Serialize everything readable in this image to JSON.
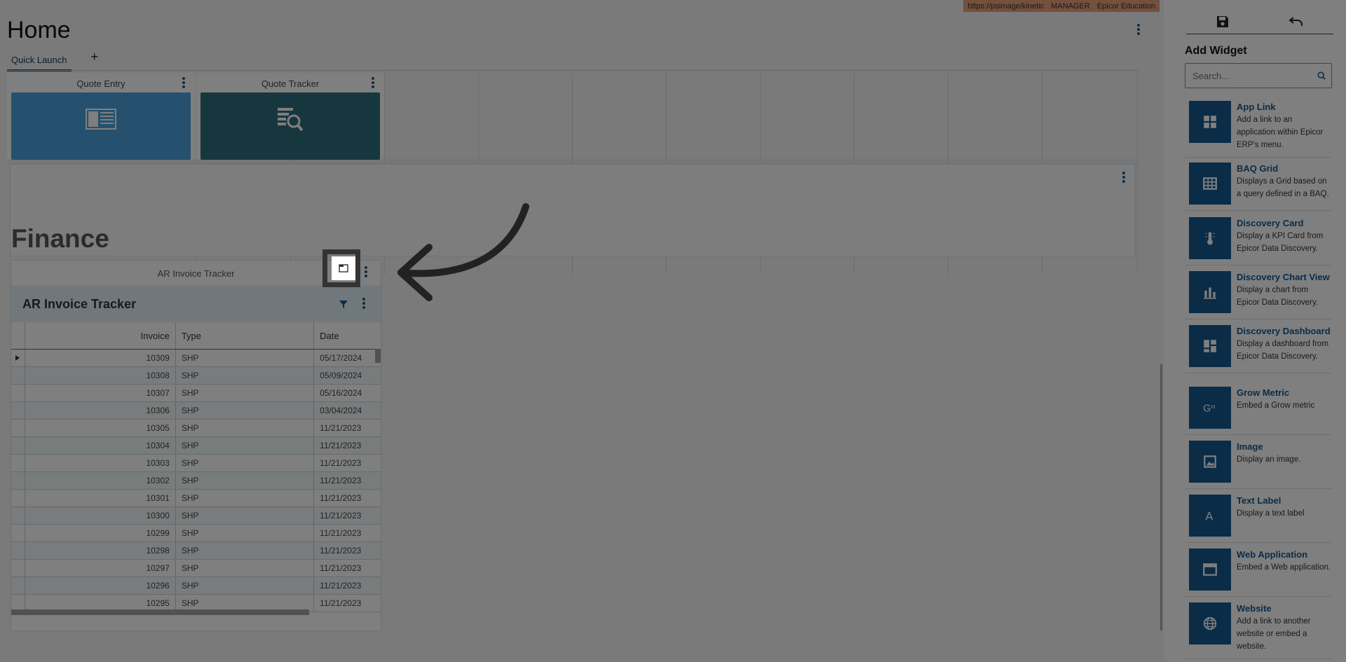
{
  "header": {
    "url": "https://psimage/kinetic",
    "user": "MANAGER",
    "company": "Epicor Education",
    "title": "Home"
  },
  "tabs": [
    {
      "label": "Quick Launch",
      "active": true
    }
  ],
  "tab_add": "+",
  "tiles": [
    {
      "title": "Quote Entry",
      "color": "#4aa3df"
    },
    {
      "title": "Quote Tracker",
      "color": "#2d6f7a"
    }
  ],
  "section": {
    "title": "Finance"
  },
  "ar_tracker": {
    "tile_title": "AR Invoice Tracker",
    "panel_title": "AR Invoice Tracker",
    "columns": [
      "Invoice",
      "Type",
      "Date"
    ],
    "rows": [
      [
        "10309",
        "SHP",
        "05/17/2024"
      ],
      [
        "10308",
        "SHP",
        "05/09/2024"
      ],
      [
        "10307",
        "SHP",
        "05/16/2024"
      ],
      [
        "10306",
        "SHP",
        "03/04/2024"
      ],
      [
        "10305",
        "SHP",
        "11/21/2023"
      ],
      [
        "10304",
        "SHP",
        "11/21/2023"
      ],
      [
        "10303",
        "SHP",
        "11/21/2023"
      ],
      [
        "10302",
        "SHP",
        "11/21/2023"
      ],
      [
        "10301",
        "SHP",
        "11/21/2023"
      ],
      [
        "10300",
        "SHP",
        "11/21/2023"
      ],
      [
        "10299",
        "SHP",
        "11/21/2023"
      ],
      [
        "10298",
        "SHP",
        "11/21/2023"
      ],
      [
        "10297",
        "SHP",
        "11/21/2023"
      ],
      [
        "10296",
        "SHP",
        "11/21/2023"
      ],
      [
        "10295",
        "SHP",
        "11/21/2023"
      ]
    ]
  },
  "side": {
    "title": "Add Widget",
    "search_placeholder": "Search...",
    "widgets": [
      {
        "name": "App Link",
        "desc": "Add a link to an application within Epicor ERP's menu.",
        "icon": "grid-icon"
      },
      {
        "name": "BAQ Grid",
        "desc": "Displays a Grid based on a query defined in a BAQ.",
        "icon": "table-icon"
      },
      {
        "name": "Discovery Card",
        "desc": "Display a KPI Card from Epicor Data Discovery.",
        "icon": "thermometer-icon"
      },
      {
        "name": "Discovery Chart View",
        "desc": "Display a chart from Epicor Data Discovery.",
        "icon": "bar-chart-icon"
      },
      {
        "name": "Discovery Dashboard",
        "desc": "Display a dashboard from Epicor Data Discovery.",
        "icon": "dashboard-icon"
      },
      {
        "name": "Grow Metric",
        "desc": "Embed a Grow metric",
        "icon": "grow-icon"
      },
      {
        "name": "Image",
        "desc": "Display an image.",
        "icon": "image-icon"
      },
      {
        "name": "Text Label",
        "desc": "Display a text label",
        "icon": "text-icon"
      },
      {
        "name": "Web Application",
        "desc": "Embed a Web application.",
        "icon": "web-app-icon"
      },
      {
        "name": "Website",
        "desc": "Add a link to another website or embed a website.",
        "icon": "globe-icon"
      }
    ]
  },
  "colors": {
    "accent": "#15588f",
    "overlay": "rgba(0,0,0,0.5)"
  }
}
